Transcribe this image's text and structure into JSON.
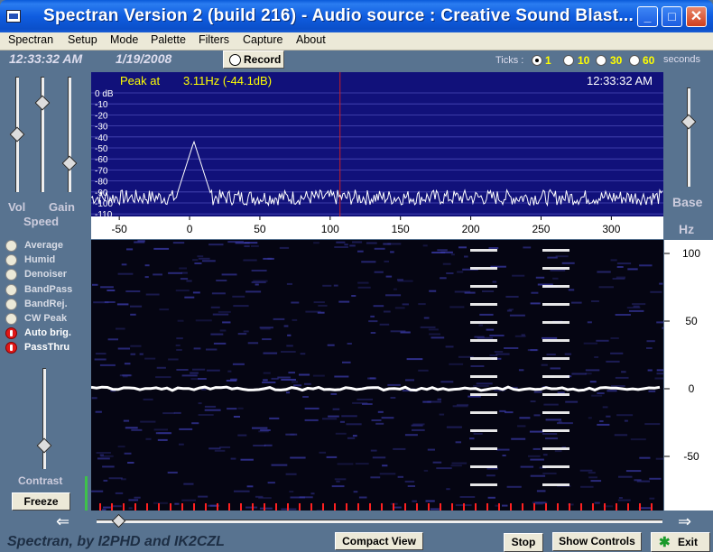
{
  "window": {
    "title": "Spectran Version 2 (build 216) - Audio source  :  Creative Sound Blast...",
    "minimize_glyph": "_",
    "maximize_glyph": "□",
    "close_glyph": "✕"
  },
  "menu": [
    "Spectran",
    "Setup",
    "Mode",
    "Palette",
    "Filters",
    "Capture",
    "About"
  ],
  "status": {
    "time": "12:33:32 AM",
    "date": "1/19/2008",
    "record_label": "Record"
  },
  "ticks": {
    "label": "Ticks :",
    "options": [
      "1",
      "10",
      "30",
      "60"
    ],
    "selected": "1",
    "unit": "seconds"
  },
  "sliders": {
    "vol_label": "Vol",
    "gain_label": "Gain",
    "speed_label": "Speed",
    "base_label": "Base",
    "hz_label": "Hz",
    "contrast_label": "Contrast",
    "vol_level": 0.5,
    "gain_level": 0.2,
    "third_level": 0.78,
    "base_level": 0.33,
    "contrast_level": 0.8
  },
  "spectrum": {
    "peak_label": "Peak at",
    "peak_value": "3.11Hz (-44.1dB)",
    "time": "12:33:32 AM",
    "db_ticks": [
      "0 dB",
      "-10",
      "-20",
      "-30",
      "-40",
      "-50",
      "-60",
      "-70",
      "-80",
      "-90",
      "-100",
      "-110"
    ],
    "x_ticks": [
      "-50",
      "0",
      "50",
      "100",
      "150",
      "200",
      "250",
      "300"
    ],
    "peak_freq_hz": 3.11,
    "peak_db": -44.1,
    "noise_floor_db": -95,
    "cursor_hz": 107,
    "colors": {
      "background": "#11117a",
      "trace": "#ffffff",
      "cursor": "#cc2020",
      "label": "#ffff00"
    }
  },
  "waterfall": {
    "scale_ticks": [
      "100",
      "50",
      "0",
      "-50"
    ],
    "carrier_offset_hz": 0,
    "colors": {
      "background": "#050512",
      "signal": "#ffffff",
      "noise": "#3a3aa8",
      "tick": "#ff2020"
    }
  },
  "toggles": [
    {
      "label": "Average",
      "on": false
    },
    {
      "label": "Humid",
      "on": false
    },
    {
      "label": "Denoiser",
      "on": false
    },
    {
      "label": "BandPass",
      "on": false
    },
    {
      "label": "BandRej.",
      "on": false
    },
    {
      "label": "CW Peak",
      "on": false
    },
    {
      "label": "Auto brig.",
      "on": true
    },
    {
      "label": "PassThru",
      "on": true
    }
  ],
  "buttons": {
    "freeze": "Freeze",
    "compact_view": "Compact View",
    "stop": "Stop",
    "show_controls": "Show Controls",
    "exit": "Exit",
    "left_arrow": "⇐",
    "right_arrow": "⇒"
  },
  "footer": "Spectran, by I2PHD and IK2CZL"
}
